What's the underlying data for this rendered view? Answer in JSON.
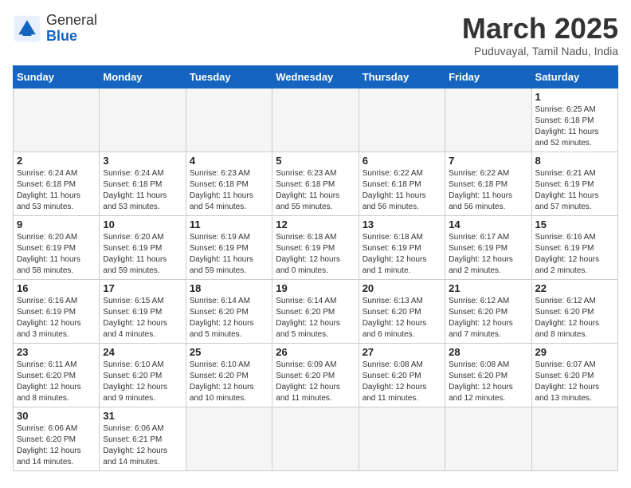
{
  "header": {
    "logo_general": "General",
    "logo_blue": "Blue",
    "month_title": "March 2025",
    "subtitle": "Puduvayal, Tamil Nadu, India"
  },
  "weekdays": [
    "Sunday",
    "Monday",
    "Tuesday",
    "Wednesday",
    "Thursday",
    "Friday",
    "Saturday"
  ],
  "weeks": [
    [
      {
        "day": "",
        "info": ""
      },
      {
        "day": "",
        "info": ""
      },
      {
        "day": "",
        "info": ""
      },
      {
        "day": "",
        "info": ""
      },
      {
        "day": "",
        "info": ""
      },
      {
        "day": "",
        "info": ""
      },
      {
        "day": "1",
        "info": "Sunrise: 6:25 AM\nSunset: 6:18 PM\nDaylight: 11 hours\nand 52 minutes."
      }
    ],
    [
      {
        "day": "2",
        "info": "Sunrise: 6:24 AM\nSunset: 6:18 PM\nDaylight: 11 hours\nand 53 minutes."
      },
      {
        "day": "3",
        "info": "Sunrise: 6:24 AM\nSunset: 6:18 PM\nDaylight: 11 hours\nand 53 minutes."
      },
      {
        "day": "4",
        "info": "Sunrise: 6:23 AM\nSunset: 6:18 PM\nDaylight: 11 hours\nand 54 minutes."
      },
      {
        "day": "5",
        "info": "Sunrise: 6:23 AM\nSunset: 6:18 PM\nDaylight: 11 hours\nand 55 minutes."
      },
      {
        "day": "6",
        "info": "Sunrise: 6:22 AM\nSunset: 6:18 PM\nDaylight: 11 hours\nand 56 minutes."
      },
      {
        "day": "7",
        "info": "Sunrise: 6:22 AM\nSunset: 6:18 PM\nDaylight: 11 hours\nand 56 minutes."
      },
      {
        "day": "8",
        "info": "Sunrise: 6:21 AM\nSunset: 6:19 PM\nDaylight: 11 hours\nand 57 minutes."
      }
    ],
    [
      {
        "day": "9",
        "info": "Sunrise: 6:20 AM\nSunset: 6:19 PM\nDaylight: 11 hours\nand 58 minutes."
      },
      {
        "day": "10",
        "info": "Sunrise: 6:20 AM\nSunset: 6:19 PM\nDaylight: 11 hours\nand 59 minutes."
      },
      {
        "day": "11",
        "info": "Sunrise: 6:19 AM\nSunset: 6:19 PM\nDaylight: 11 hours\nand 59 minutes."
      },
      {
        "day": "12",
        "info": "Sunrise: 6:18 AM\nSunset: 6:19 PM\nDaylight: 12 hours\nand 0 minutes."
      },
      {
        "day": "13",
        "info": "Sunrise: 6:18 AM\nSunset: 6:19 PM\nDaylight: 12 hours\nand 1 minute."
      },
      {
        "day": "14",
        "info": "Sunrise: 6:17 AM\nSunset: 6:19 PM\nDaylight: 12 hours\nand 2 minutes."
      },
      {
        "day": "15",
        "info": "Sunrise: 6:16 AM\nSunset: 6:19 PM\nDaylight: 12 hours\nand 2 minutes."
      }
    ],
    [
      {
        "day": "16",
        "info": "Sunrise: 6:16 AM\nSunset: 6:19 PM\nDaylight: 12 hours\nand 3 minutes."
      },
      {
        "day": "17",
        "info": "Sunrise: 6:15 AM\nSunset: 6:19 PM\nDaylight: 12 hours\nand 4 minutes."
      },
      {
        "day": "18",
        "info": "Sunrise: 6:14 AM\nSunset: 6:20 PM\nDaylight: 12 hours\nand 5 minutes."
      },
      {
        "day": "19",
        "info": "Sunrise: 6:14 AM\nSunset: 6:20 PM\nDaylight: 12 hours\nand 5 minutes."
      },
      {
        "day": "20",
        "info": "Sunrise: 6:13 AM\nSunset: 6:20 PM\nDaylight: 12 hours\nand 6 minutes."
      },
      {
        "day": "21",
        "info": "Sunrise: 6:12 AM\nSunset: 6:20 PM\nDaylight: 12 hours\nand 7 minutes."
      },
      {
        "day": "22",
        "info": "Sunrise: 6:12 AM\nSunset: 6:20 PM\nDaylight: 12 hours\nand 8 minutes."
      }
    ],
    [
      {
        "day": "23",
        "info": "Sunrise: 6:11 AM\nSunset: 6:20 PM\nDaylight: 12 hours\nand 8 minutes."
      },
      {
        "day": "24",
        "info": "Sunrise: 6:10 AM\nSunset: 6:20 PM\nDaylight: 12 hours\nand 9 minutes."
      },
      {
        "day": "25",
        "info": "Sunrise: 6:10 AM\nSunset: 6:20 PM\nDaylight: 12 hours\nand 10 minutes."
      },
      {
        "day": "26",
        "info": "Sunrise: 6:09 AM\nSunset: 6:20 PM\nDaylight: 12 hours\nand 11 minutes."
      },
      {
        "day": "27",
        "info": "Sunrise: 6:08 AM\nSunset: 6:20 PM\nDaylight: 12 hours\nand 11 minutes."
      },
      {
        "day": "28",
        "info": "Sunrise: 6:08 AM\nSunset: 6:20 PM\nDaylight: 12 hours\nand 12 minutes."
      },
      {
        "day": "29",
        "info": "Sunrise: 6:07 AM\nSunset: 6:20 PM\nDaylight: 12 hours\nand 13 minutes."
      }
    ],
    [
      {
        "day": "30",
        "info": "Sunrise: 6:06 AM\nSunset: 6:20 PM\nDaylight: 12 hours\nand 14 minutes."
      },
      {
        "day": "31",
        "info": "Sunrise: 6:06 AM\nSunset: 6:21 PM\nDaylight: 12 hours\nand 14 minutes."
      },
      {
        "day": "",
        "info": ""
      },
      {
        "day": "",
        "info": ""
      },
      {
        "day": "",
        "info": ""
      },
      {
        "day": "",
        "info": ""
      },
      {
        "day": "",
        "info": ""
      }
    ]
  ]
}
